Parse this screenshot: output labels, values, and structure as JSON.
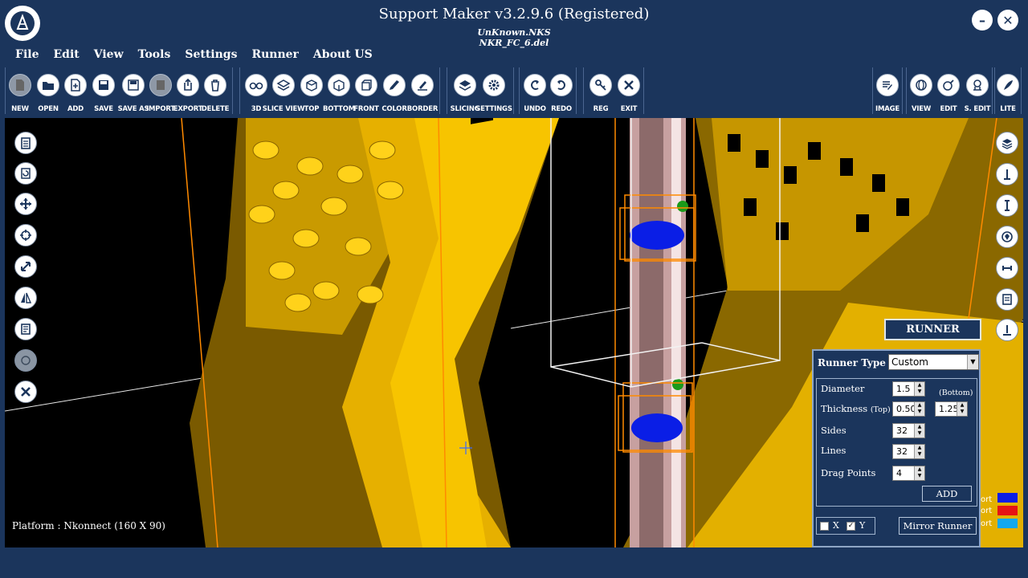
{
  "window": {
    "title": "Support Maker v3.2.9.6 (Registered)",
    "user": "UnKnown.NKS",
    "file": "NKR_FC_6.del",
    "minimize_glyph": "–",
    "close_glyph": "✕"
  },
  "menu": [
    "File",
    "Edit",
    "View",
    "Tools",
    "Settings",
    "Runner",
    "About US"
  ],
  "toolbar": {
    "new": "NEW",
    "open": "OPEN",
    "add": "ADD",
    "save": "SAVE",
    "save_as": "SAVE AS",
    "import": "IMPORT",
    "export": "EXPORT",
    "delete": "DELETE",
    "view3d": "3D",
    "slice_view": "SLICE VIEW",
    "top": "TOP",
    "bottom": "BOTTOM",
    "front": "FRONT",
    "color": "COLOR",
    "border": "BORDER",
    "slicing": "SLICING",
    "settings": "SETTINGS",
    "undo": "UNDO",
    "redo": "REDO",
    "reg": "REG",
    "exit": "EXIT",
    "image": "IMAGE",
    "view": "VIEW",
    "edit": "EDIT",
    "s_edit": "S. EDIT",
    "lite": "LITE"
  },
  "viewport": {
    "platform": "Platform : Nkonnect  (160 X 90)"
  },
  "runner": {
    "header": "RUNNER",
    "type_label": "Runner Type",
    "type_value": "Custom",
    "diameter_label": "Diameter",
    "diameter": "1.5",
    "bottom_label": "(Bottom)",
    "thickness_label": "Thickness",
    "top_label": "(Top)",
    "thickness_top": "0.50",
    "thickness_bottom": "1.25",
    "sides_label": "Sides",
    "sides": "32",
    "lines_label": "Lines",
    "lines": "32",
    "drag_label": "Drag Points",
    "drag_points": "4",
    "add": "ADD",
    "x_label": "X",
    "y_label": "Y",
    "mirror": "Mirror Runner"
  },
  "legend": [
    {
      "text": "ort",
      "color": "#0a1ee6"
    },
    {
      "text": "ort",
      "color": "#e61414"
    },
    {
      "text": "ort",
      "color": "#12a8f0"
    }
  ]
}
